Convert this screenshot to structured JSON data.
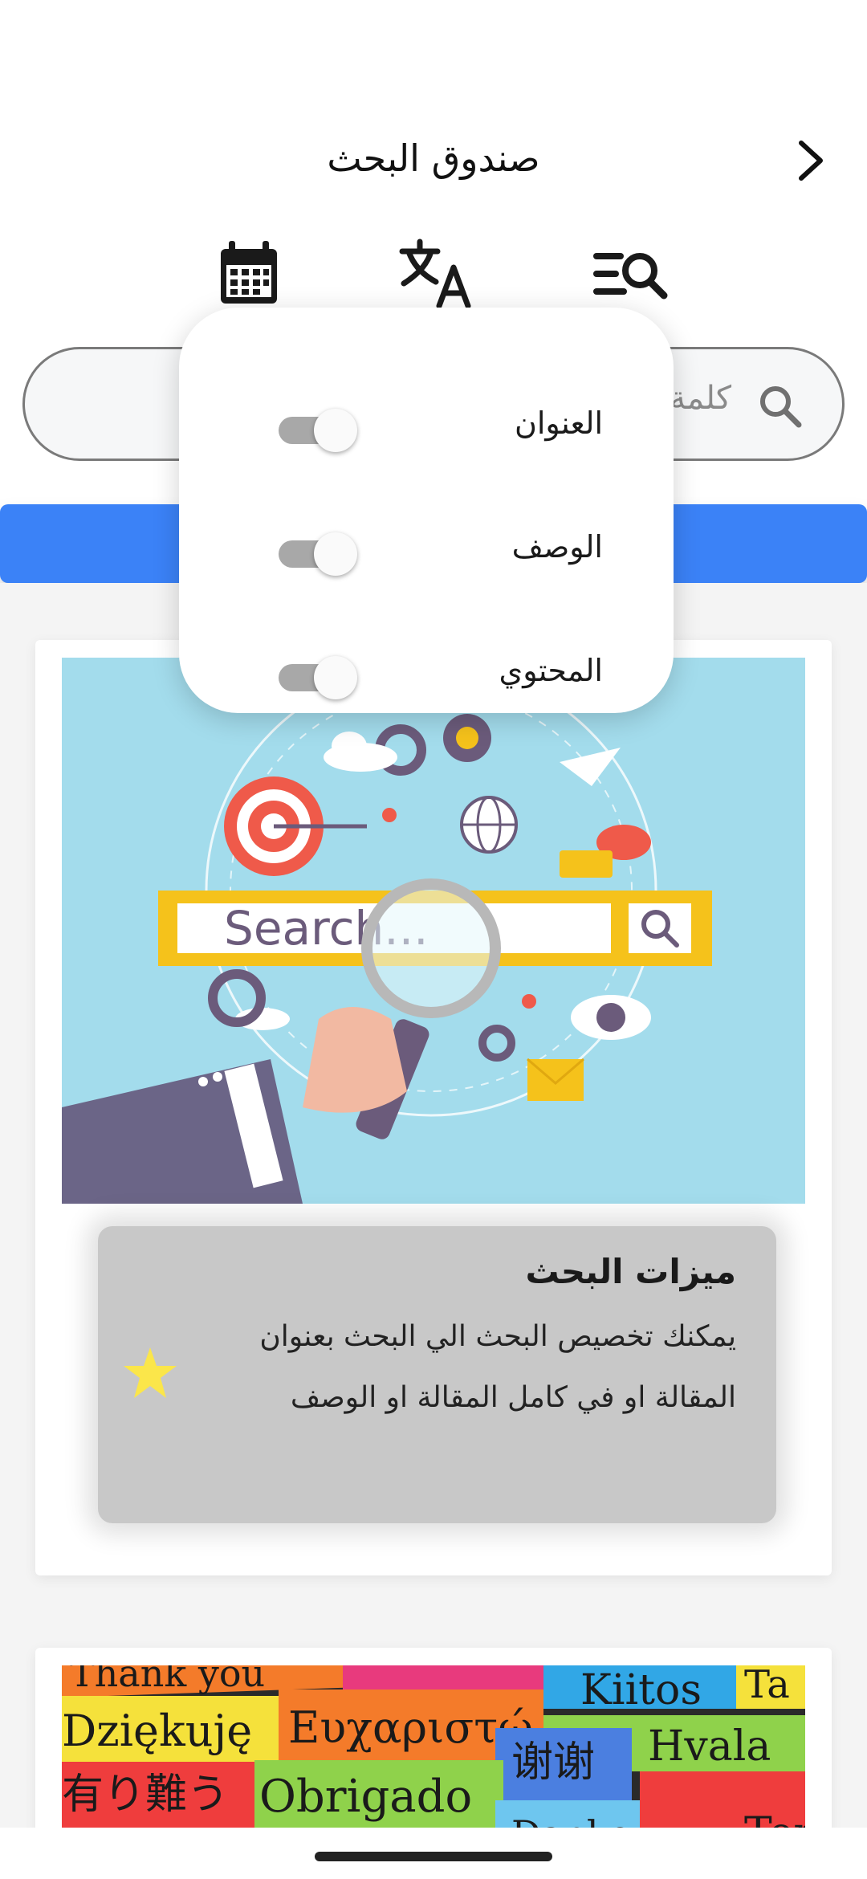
{
  "header": {
    "title": "صندوق البحث"
  },
  "toolbar": {
    "items": [
      {
        "icon": "calendar-icon"
      },
      {
        "icon": "translate-icon"
      },
      {
        "icon": "search-list-icon"
      }
    ]
  },
  "search": {
    "placeholder": "كلمة"
  },
  "filter_popover": {
    "options": [
      {
        "label": "العنوان",
        "enabled": false
      },
      {
        "label": "الوصف",
        "enabled": false
      },
      {
        "label": "المحتوي",
        "enabled": false
      }
    ]
  },
  "cards": [
    {
      "image_text": "Search...",
      "feature_title": "ميزات البحث",
      "feature_desc": "يمكنك تخصيص البحث الي البحث بعنوان المقالة او في كامل المقالة او الوصف"
    },
    {
      "image_words": [
        "Thank you",
        "Dziękuję",
        "Ευχαριστώ",
        "Kiitos",
        "Ta",
        "有り難う",
        "Obrigado",
        "谢谢",
        "Hvala",
        "Danke",
        "Ter"
      ]
    }
  ],
  "colors": {
    "accent": "#3b82f7",
    "feature_bg": "#c8c8c8",
    "star": "#fbe64a"
  }
}
